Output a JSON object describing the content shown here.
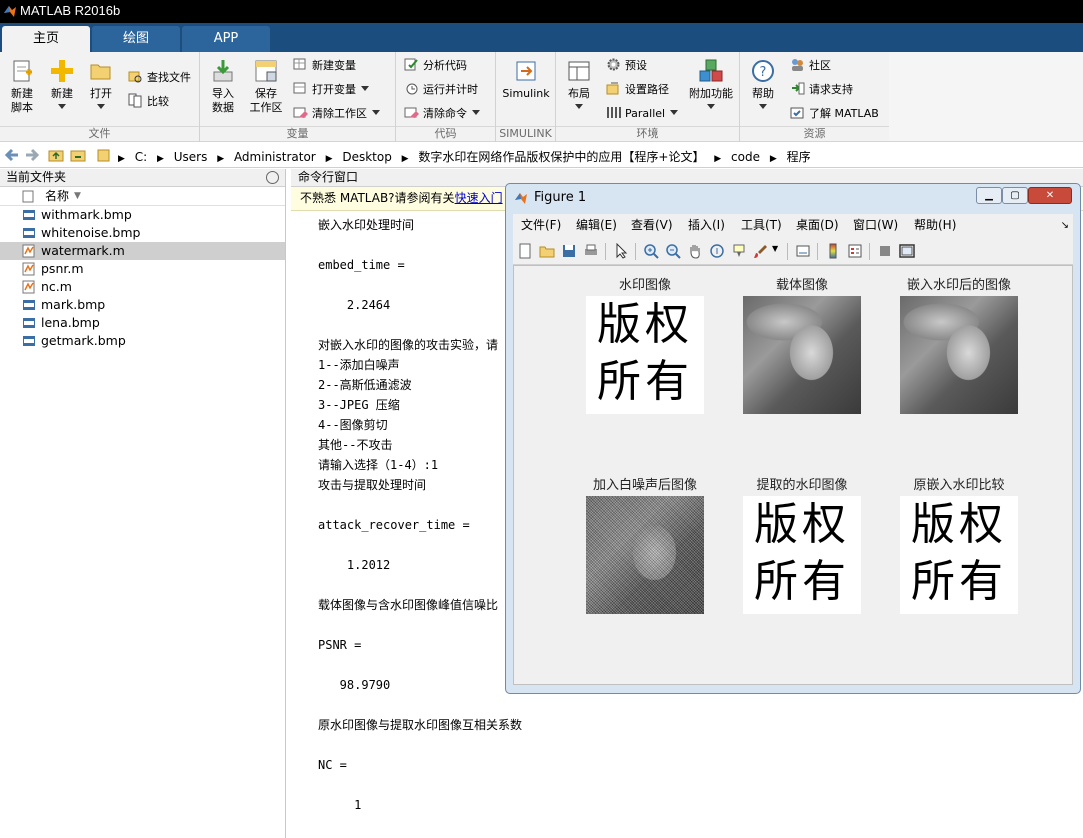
{
  "window": {
    "title": "MATLAB R2016b"
  },
  "tabs": [
    {
      "label": "主页",
      "active": true
    },
    {
      "label": "绘图",
      "active": false
    },
    {
      "label": "APP",
      "active": false
    }
  ],
  "ribbon": {
    "file": {
      "label": "文件",
      "new_script": "新建\n脚本",
      "new": "新建",
      "open": "打开",
      "find_files": "查找文件",
      "compare": "比较"
    },
    "variable": {
      "label": "变量",
      "import": "导入\n数据",
      "save_workspace": "保存\n工作区",
      "new_variable": "新建变量",
      "open_variable": "打开变量",
      "clear_workspace": "清除工作区"
    },
    "code": {
      "label": "代码",
      "analyze": "分析代码",
      "run_time": "运行并计时",
      "clear_commands": "清除命令"
    },
    "simulink": {
      "label": "SIMULINK",
      "button": "Simulink"
    },
    "environment": {
      "label": "环境",
      "layout": "布局",
      "preferences": "预设",
      "set_path": "设置路径",
      "parallel": "Parallel",
      "addons": "附加功能"
    },
    "resources": {
      "label": "资源",
      "help": "帮助",
      "community": "社区",
      "support": "请求支持",
      "learn": "了解 MATLAB"
    }
  },
  "address": {
    "crumbs": [
      "C:",
      "Users",
      "Administrator",
      "Desktop",
      "数字水印在网络作品版权保护中的应用【程序+论文】",
      "code",
      "程序"
    ]
  },
  "current_folder": {
    "title": "当前文件夹",
    "column": "名称",
    "files": [
      {
        "name": "withmark.bmp",
        "type": "bmp",
        "selected": false
      },
      {
        "name": "whitenoise.bmp",
        "type": "bmp",
        "selected": false
      },
      {
        "name": "watermark.m",
        "type": "m",
        "selected": true
      },
      {
        "name": "psnr.m",
        "type": "m",
        "selected": false
      },
      {
        "name": "nc.m",
        "type": "m",
        "selected": false
      },
      {
        "name": "mark.bmp",
        "type": "bmp",
        "selected": false
      },
      {
        "name": "lena.bmp",
        "type": "bmp",
        "selected": false
      },
      {
        "name": "getmark.bmp",
        "type": "bmp",
        "selected": false
      }
    ]
  },
  "command_window": {
    "title": "命令行窗口",
    "notice_text": "不熟悉 MATLAB?请参阅有关",
    "notice_link": "快速入门",
    "lines": [
      "嵌入水印处理时间",
      "",
      "embed_time =",
      "",
      "    2.2464",
      "",
      "对嵌入水印的图像的攻击实验，请",
      "1--添加白噪声",
      "2--高斯低通滤波",
      "3--JPEG 压缩",
      "4--图像剪切",
      "其他--不攻击",
      "请输入选择（1-4）:1",
      "攻击与提取处理时间",
      "",
      "attack_recover_time =",
      "",
      "    1.2012",
      "",
      "载体图像与含水印图像峰值信噪比",
      "",
      "PSNR =",
      "",
      "   98.9790",
      "",
      "原水印图像与提取水印图像互相关系数",
      "",
      "NC =",
      "",
      "     1"
    ]
  },
  "figure": {
    "title": "Figure 1",
    "menu": [
      "文件(F)",
      "编辑(E)",
      "查看(V)",
      "插入(I)",
      "工具(T)",
      "桌面(D)",
      "窗口(W)",
      "帮助(H)"
    ],
    "panels": [
      {
        "title": "水印图像",
        "kind": "watermark",
        "text1": "版权",
        "text2": "所有"
      },
      {
        "title": "载体图像",
        "kind": "photo"
      },
      {
        "title": "嵌入水印后的图像",
        "kind": "photo"
      },
      {
        "title": "加入白噪声后图像",
        "kind": "noisy"
      },
      {
        "title": "提取的水印图像",
        "kind": "watermark",
        "text1": "版权",
        "text2": "所有"
      },
      {
        "title": "原嵌入水印比较",
        "kind": "watermark",
        "text1": "版权",
        "text2": "所有"
      }
    ]
  }
}
